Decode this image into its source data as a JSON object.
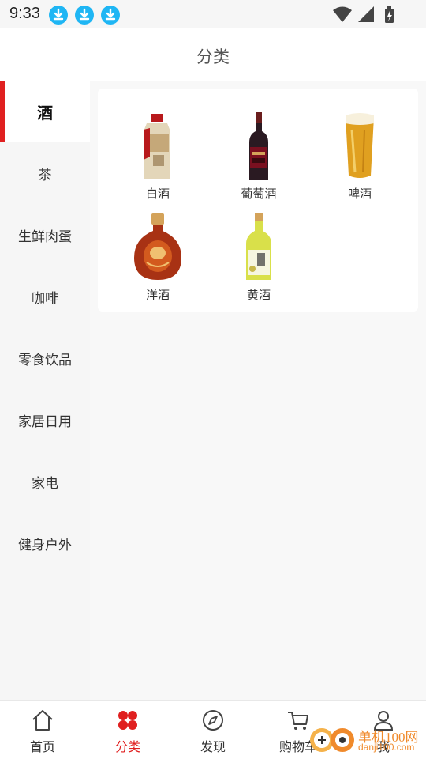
{
  "status_bar": {
    "time": "9:33",
    "icons": [
      "download-icon",
      "download-icon",
      "download-icon",
      "wifi-icon",
      "signal-icon",
      "battery-charging-icon"
    ]
  },
  "header": {
    "title": "分类"
  },
  "sidebar": {
    "items": [
      {
        "label": "酒",
        "active": true
      },
      {
        "label": "茶"
      },
      {
        "label": "生鲜肉蛋"
      },
      {
        "label": "咖啡"
      },
      {
        "label": "零食饮品"
      },
      {
        "label": "家居日用"
      },
      {
        "label": "家电"
      },
      {
        "label": "健身户外"
      }
    ]
  },
  "categories": [
    {
      "label": "白酒",
      "icon": "baijiu-bottle-image"
    },
    {
      "label": "葡萄酒",
      "icon": "wine-bottle-image"
    },
    {
      "label": "啤酒",
      "icon": "beer-glass-image"
    },
    {
      "label": "洋酒",
      "icon": "cognac-bottle-image"
    },
    {
      "label": "黄酒",
      "icon": "yellow-wine-bottle-image"
    }
  ],
  "tabbar": {
    "items": [
      {
        "label": "首页",
        "icon": "home-icon"
      },
      {
        "label": "分类",
        "icon": "category-icon",
        "active": true
      },
      {
        "label": "发现",
        "icon": "compass-icon"
      },
      {
        "label": "购物车",
        "icon": "cart-icon"
      },
      {
        "label": "我",
        "icon": "user-icon"
      }
    ]
  },
  "watermark": {
    "line1": "单机100网",
    "line2": "danji100.com"
  },
  "colors": {
    "accent": "#e02020",
    "download_badge": "#1fb6f4",
    "watermark": "#f08a2b"
  }
}
